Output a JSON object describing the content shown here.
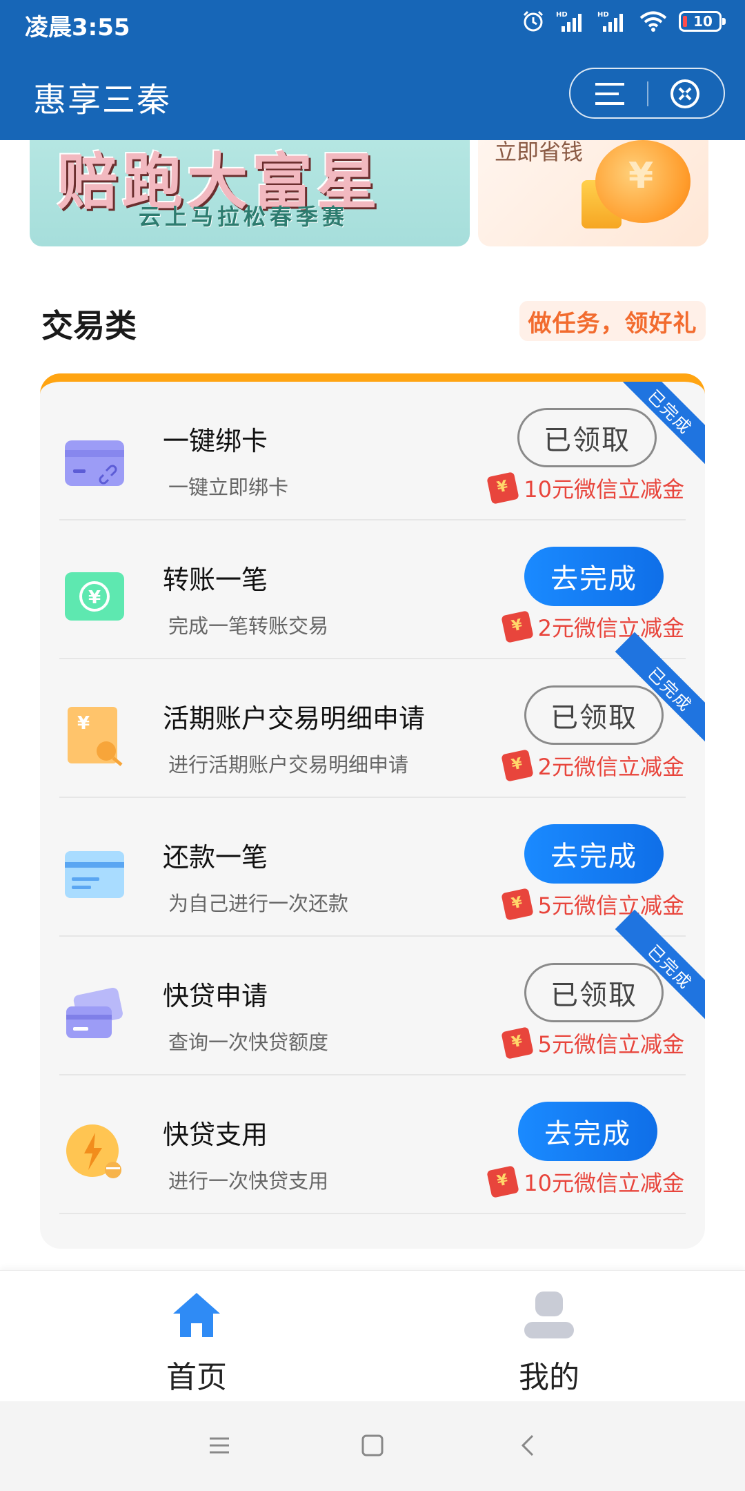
{
  "status_bar": {
    "time": "凌晨3:55",
    "battery": "10",
    "signal1": "HD",
    "signal2": "HD"
  },
  "header": {
    "title": "惠享三秦"
  },
  "banners": {
    "left_title": "赔跑大富星",
    "left_subtitle": "云上马拉松春季赛",
    "right_text": "立即省钱"
  },
  "section": {
    "title": "交易类",
    "tag": "做任务，领好礼"
  },
  "tasks": [
    {
      "title": "一键绑卡",
      "desc": "一键立即绑卡",
      "button": "已领取",
      "status": "done",
      "ribbon": "已完成",
      "reward": "10元微信立减金"
    },
    {
      "title": "转账一笔",
      "desc": "完成一笔转账交易",
      "button": "去完成",
      "status": "todo",
      "ribbon": "",
      "reward": "2元微信立减金"
    },
    {
      "title": "活期账户交易明细申请",
      "desc": "进行活期账户交易明细申请",
      "button": "已领取",
      "status": "done",
      "ribbon": "已完成",
      "reward": "2元微信立减金"
    },
    {
      "title": "还款一笔",
      "desc": "为自己进行一次还款",
      "button": "去完成",
      "status": "todo",
      "ribbon": "",
      "reward": "5元微信立减金"
    },
    {
      "title": "快贷申请",
      "desc": "查询一次快贷额度",
      "button": "已领取",
      "status": "done",
      "ribbon": "已完成",
      "reward": "5元微信立减金"
    },
    {
      "title": "快贷支用",
      "desc": "进行一次快贷支用",
      "button": "去完成",
      "status": "todo",
      "ribbon": "",
      "reward": "10元微信立减金"
    }
  ],
  "tabbar": {
    "home": "首页",
    "mine": "我的"
  },
  "colors": {
    "header": "#1766b7",
    "accent": "#1a8aff",
    "reward": "#e8453c",
    "card_top": "#ffa412"
  }
}
